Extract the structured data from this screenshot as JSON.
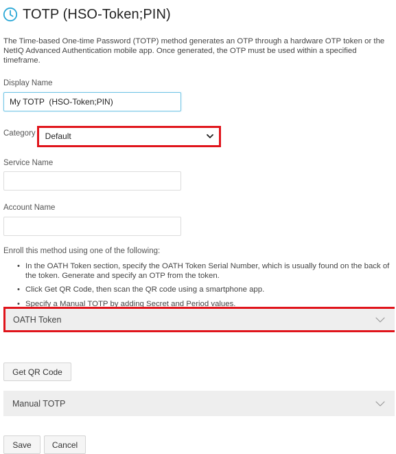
{
  "header": {
    "icon": "clock-icon",
    "title": "TOTP (HSO-Token;PIN)"
  },
  "description": "The Time-based One-time Password (TOTP) method generates an OTP through a hardware OTP token or the NetIQ Advanced Authentication mobile app. Once generated, the OTP must be used within a specified timeframe.",
  "display_name": {
    "label": "Display Name",
    "value": "My TOTP  (HSO-Token;PIN)"
  },
  "category": {
    "label": "Category",
    "selected": "Default"
  },
  "service_name": {
    "label": "Service Name",
    "value": ""
  },
  "account_name": {
    "label": "Account Name",
    "value": ""
  },
  "enroll": {
    "intro": "Enroll this method using one of the following:",
    "items": [
      "In the OATH Token section, specify the OATH Token Serial Number, which is usually found on the back of the token. Generate and specify an OTP from the token.",
      "Click Get QR Code, then scan the QR code using a smartphone app.",
      "Specify a Manual TOTP by adding Secret and Period values."
    ]
  },
  "sections": {
    "oath_token": "OATH Token",
    "manual_totp": "Manual TOTP"
  },
  "buttons": {
    "get_qr": "Get QR Code",
    "save": "Save",
    "cancel": "Cancel"
  },
  "colors": {
    "accent": "#2aa7d6",
    "highlight": "#e0141b",
    "panel": "#eeeeee"
  }
}
